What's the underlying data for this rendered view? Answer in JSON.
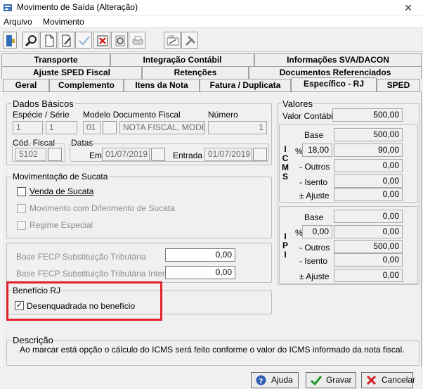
{
  "window": {
    "title": "Movimento de Saída (Alteração)",
    "close_glyph": "✕",
    "icon": "app-icon"
  },
  "menu": {
    "items": [
      "Arquivo",
      "Movimento"
    ]
  },
  "toolbar": {
    "buttons": [
      "exit-icon",
      "search-icon",
      "new-document-icon",
      "edit-icon",
      "confirm-icon",
      "delete-icon",
      "refresh-icon",
      "print-icon",
      "iss-icon",
      "tools-icon"
    ]
  },
  "tabs": {
    "row1": [
      "Transporte",
      "Integração Contábil",
      "Informações SVA/DACON"
    ],
    "row2": [
      "Ajuste SPED Fiscal",
      "Retenções",
      "Documentos Referenciados"
    ],
    "row3": [
      "Geral",
      "Complemento",
      "Itens da Nota",
      "Fatura / Duplicata",
      "Específico - RJ",
      "SPED"
    ],
    "active": "Específico - RJ"
  },
  "dados_basicos": {
    "title": "Dados Básicos",
    "especie_serie_label": "Espécie  /  Série",
    "modelo_label": "Modelo Documento Fiscal",
    "numero_label": "Número",
    "especie": "1",
    "serie": "1",
    "modelo_code": "01",
    "modelo_desc": "NOTA FISCAL, MODELO",
    "numero": "1",
    "cfop_label": "Cód. Fiscal",
    "cfop": "5102",
    "datas_label": "Datas",
    "emissao_label": "Emissão",
    "emissao": "01/07/2019",
    "entrada_label": "Entrada",
    "entrada": "01/07/2019"
  },
  "sucata": {
    "title": "Movimentação de Sucata",
    "venda": "Venda de Sucata",
    "diferimento": "Movimento com Diferimento de Sucata",
    "regime": "Regime Especial"
  },
  "fecp": {
    "st_label": "Base FECP Substituição Tributária",
    "st_value": "0,00",
    "interna_label": "Base FECP Substituição Tributária Interna",
    "interna_value": "0,00"
  },
  "beneficio": {
    "title": "Benefício RJ",
    "check_label": "Desenquadrada no benefício",
    "checked": "✓",
    "highlight_color": "#e0242b"
  },
  "valores": {
    "title": "Valores",
    "valor_contabil_label": "Valor Contábil",
    "valor_contabil": "500,00",
    "icms": {
      "letters": [
        "I",
        "C",
        "M",
        "S"
      ],
      "base_label": "Base",
      "base": "500,00",
      "pct_symbol": "%",
      "aliquota": "18,00",
      "valor": "90,00",
      "outros_label": "- Outros",
      "outros": "0,00",
      "isento_label": "- Isento",
      "isento": "0,00",
      "ajuste_label": "± Ajuste",
      "ajuste": "0,00"
    },
    "ipi": {
      "letters": [
        "I",
        "P",
        "I"
      ],
      "base_label": "Base",
      "base": "0,00",
      "pct_symbol": "%",
      "aliquota": "0,00",
      "valor": "0,00",
      "outros_label": "- Outros",
      "outros": "500,00",
      "isento_label": "- Isento",
      "isento": "0,00",
      "ajuste_label": "± Ajuste",
      "ajuste": "0,00"
    }
  },
  "descricao": {
    "title": "Descrição",
    "text": "Ao marcar está opção o cálculo do ICMS será feito conforme o valor do ICMS informado da nota fiscal."
  },
  "buttons": {
    "ajuda": "Ajuda",
    "gravar": "Gravar",
    "cancelar": "Cancelar"
  }
}
